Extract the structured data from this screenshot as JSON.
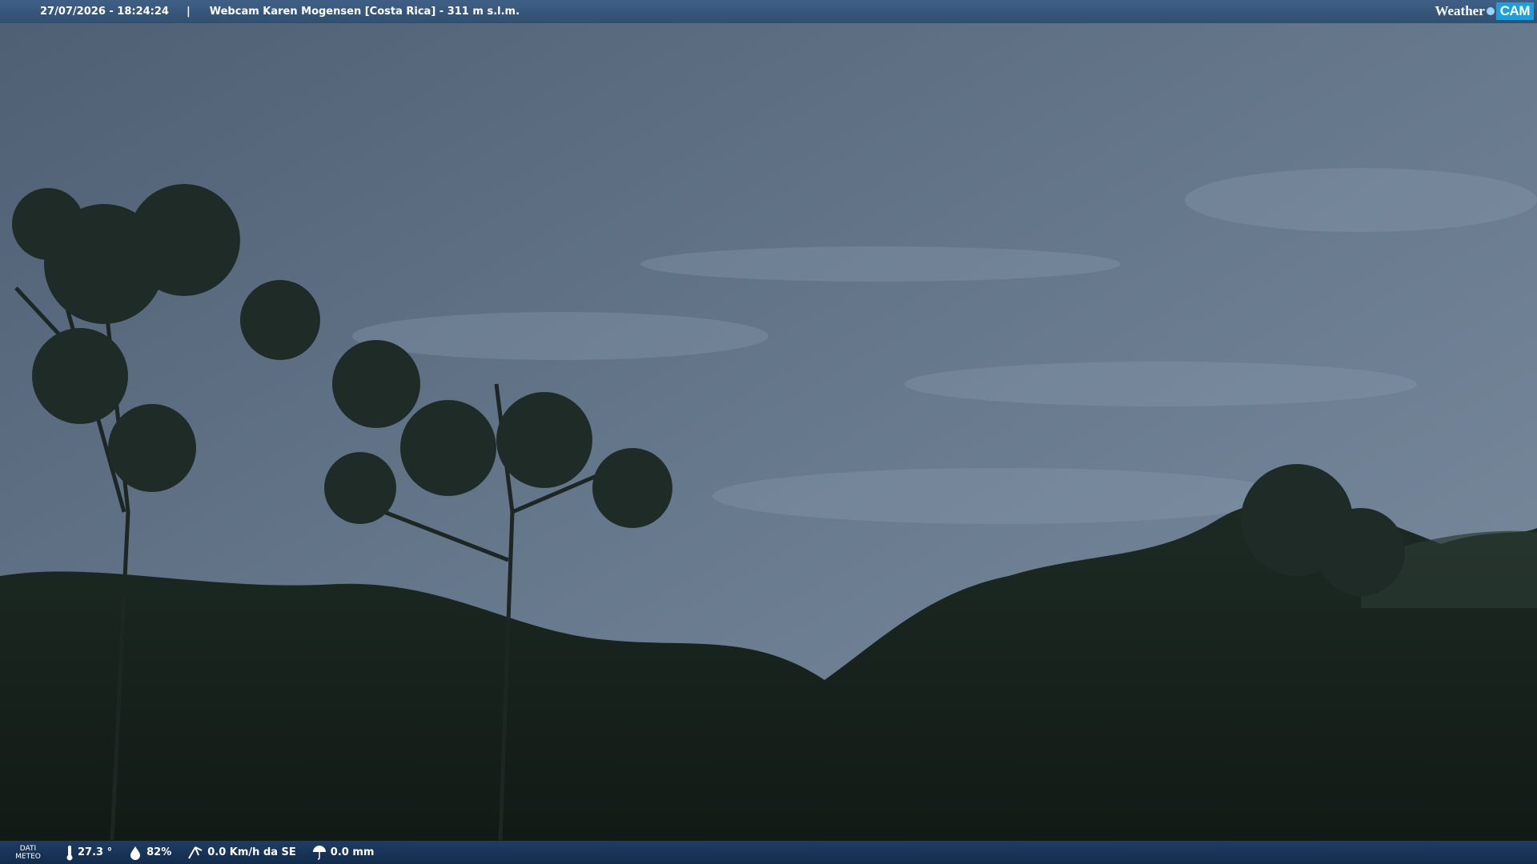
{
  "header": {
    "datetime": "27/07/2026 - 18:24:24",
    "separator": "|",
    "title": "Webcam Karen Mogensen [Costa Rica] - 311 m s.l.m."
  },
  "logo": {
    "weather": "Weather",
    "cam": "CAM"
  },
  "footer": {
    "dati_line1": "DATI",
    "dati_line2": "METEO",
    "temperature": "27.3 °",
    "humidity": "82%",
    "wind": "0.0 Km/h da SE",
    "rain": "0.0 mm"
  },
  "icons": [
    "thermometer-icon",
    "humidity-icon",
    "wind-icon",
    "rain-icon"
  ],
  "colors": {
    "top_bar": "#3a5a80",
    "bottom_bar": "#1a355a",
    "sky": "#5d6e82",
    "logo_accent": "#1aa0e0"
  }
}
